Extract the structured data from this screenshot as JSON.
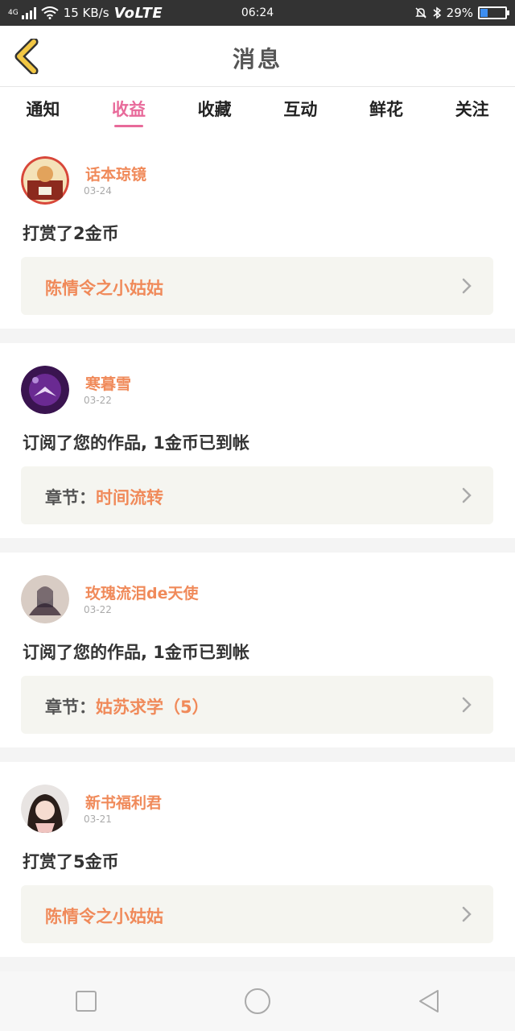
{
  "status_bar": {
    "network": "4G",
    "speed": "15 KB/s",
    "volte": "VoLTE",
    "time": "06:24",
    "battery": "29%",
    "battery_level": 0.29
  },
  "header": {
    "title": "消息"
  },
  "tabs": [
    {
      "label": "通知",
      "active": false
    },
    {
      "label": "收益",
      "active": true
    },
    {
      "label": "收藏",
      "active": false
    },
    {
      "label": "互动",
      "active": false
    },
    {
      "label": "鲜花",
      "active": false
    },
    {
      "label": "关注",
      "active": false
    }
  ],
  "feed": [
    {
      "username": "话本琼镜",
      "date": "03-24",
      "message": "打赏了2金币",
      "work_prefix": "",
      "work_title": "陈情令之小姑姑"
    },
    {
      "username": "寒暮雪",
      "date": "03-22",
      "message": "订阅了您的作品, 1金币已到帐",
      "work_prefix": "章节：",
      "work_title": "时间流转"
    },
    {
      "username": "玫瑰流泪de天使",
      "date": "03-22",
      "message": "订阅了您的作品, 1金币已到帐",
      "work_prefix": "章节：",
      "work_title": "姑苏求学（5）"
    },
    {
      "username": "新书福利君",
      "date": "03-21",
      "message": "打赏了5金币",
      "work_prefix": "",
      "work_title": "陈情令之小姑姑"
    }
  ],
  "colors": {
    "accent": "#e86a9a",
    "username": "#f08a5a",
    "back_icon": "#f2c744"
  },
  "icons": {
    "back": "chevron-left-icon",
    "item_arrow": "chevron-right-icon",
    "nav_recent": "square-icon",
    "nav_home": "circle-icon",
    "nav_back": "triangle-back-icon"
  }
}
